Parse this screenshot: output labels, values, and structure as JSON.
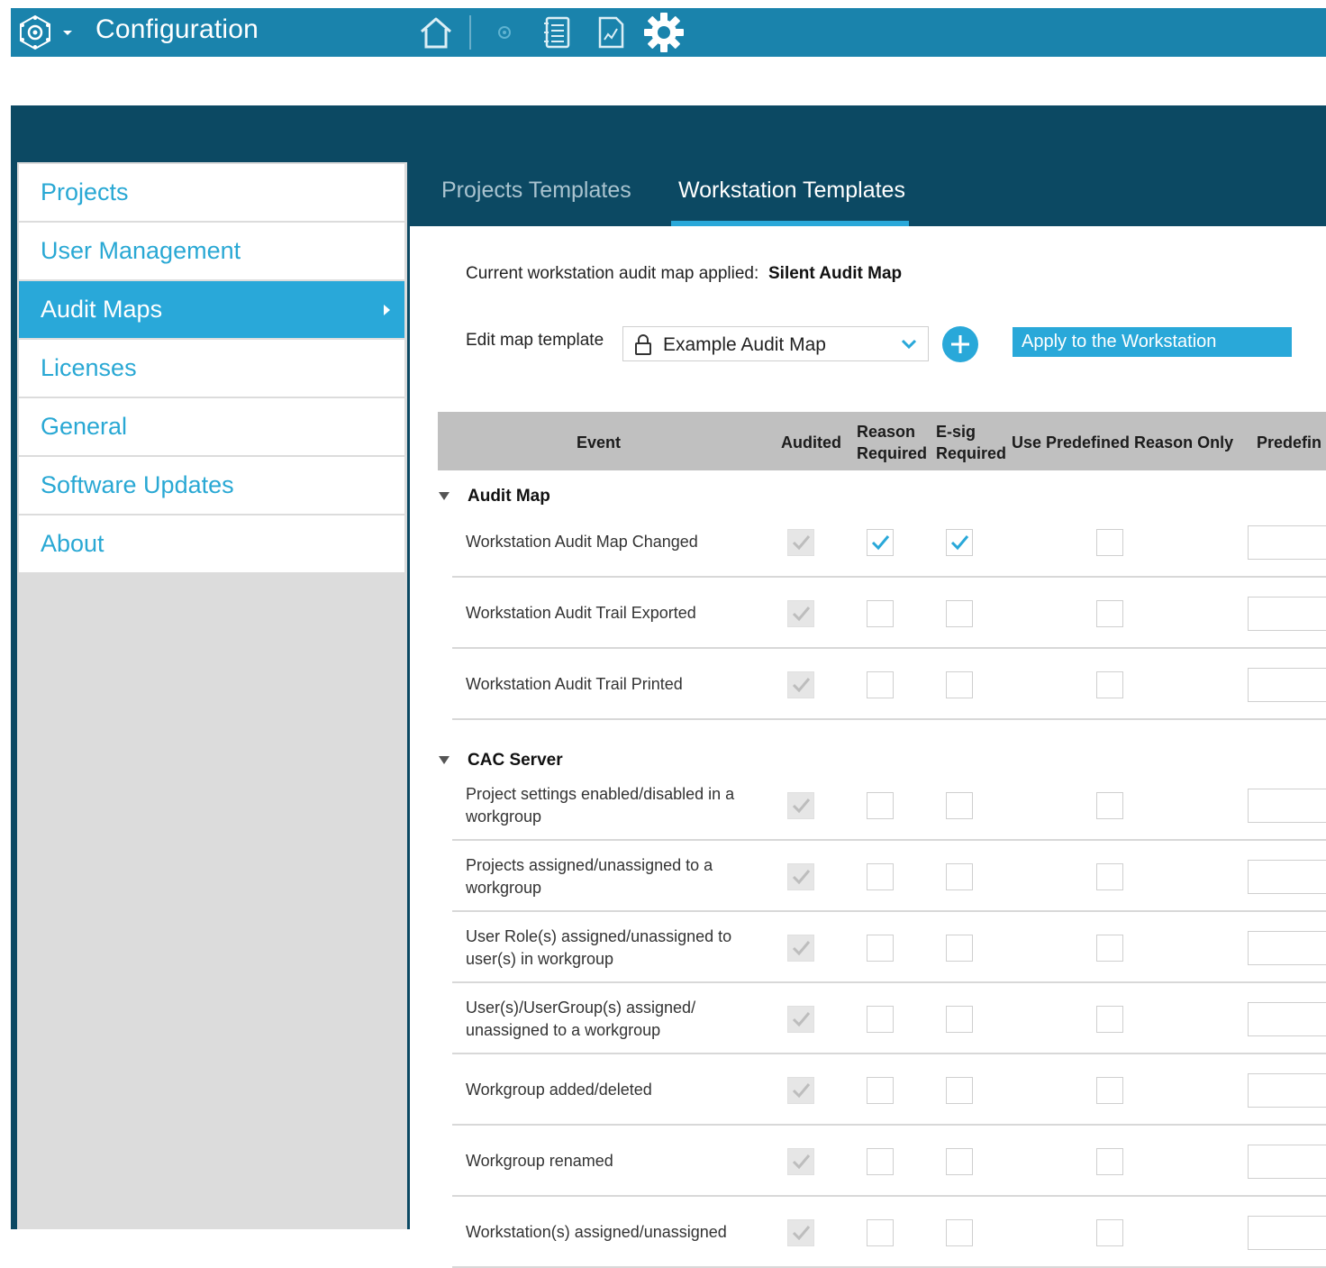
{
  "app": {
    "title": "Configuration",
    "accent": "#1a83ac",
    "toolbar_icons": [
      "app-logo-icon",
      "dropdown-caret-icon",
      "home-icon",
      "small-gear-icon",
      "notebook-icon",
      "report-icon",
      "settings-gear-icon"
    ]
  },
  "sidebar": {
    "items": [
      {
        "label": "Projects"
      },
      {
        "label": "User Management"
      },
      {
        "label": "Audit Maps",
        "active": true
      },
      {
        "label": "Licenses"
      },
      {
        "label": "General"
      },
      {
        "label": "Software Updates"
      },
      {
        "label": "About"
      }
    ]
  },
  "tabs": [
    {
      "label": "Projects Templates"
    },
    {
      "label": "Workstation Templates",
      "active": true
    }
  ],
  "current": {
    "label": "Current workstation audit map applied:",
    "value": "Silent Audit Map"
  },
  "edit": {
    "label": "Edit map template",
    "selected": "Example Audit Map",
    "apply_label": "Apply to the Workstation"
  },
  "table": {
    "headers": {
      "event": "Event",
      "audited": "Audited",
      "reason_1": "Reason",
      "reason_2": "Required",
      "esig_1": "E-sig",
      "esig_2": "Required",
      "predefined_only": "Use Predefined Reason Only",
      "predefined": "Predefin"
    },
    "groups": [
      {
        "title": "Audit Map",
        "rows": [
          {
            "event": "Workstation Audit Map Changed",
            "audited": true,
            "reason": true,
            "esig": true,
            "predefined_only": false
          },
          {
            "event": "Workstation Audit Trail Exported",
            "audited": true,
            "reason": false,
            "esig": false,
            "predefined_only": false
          },
          {
            "event": "Workstation Audit Trail Printed",
            "audited": true,
            "reason": false,
            "esig": false,
            "predefined_only": false
          }
        ]
      },
      {
        "title": "CAC Server",
        "rows": [
          {
            "event": "Project settings enabled/disabled in a workgroup",
            "audited": true,
            "reason": false,
            "esig": false,
            "predefined_only": false
          },
          {
            "event": "Projects assigned/unassigned to a workgroup",
            "audited": true,
            "reason": false,
            "esig": false,
            "predefined_only": false
          },
          {
            "event": "User Role(s) assigned/unassigned to user(s) in workgroup",
            "audited": true,
            "reason": false,
            "esig": false,
            "predefined_only": false
          },
          {
            "event": "User(s)/UserGroup(s) assigned/ unassigned to a workgroup",
            "audited": true,
            "reason": false,
            "esig": false,
            "predefined_only": false
          },
          {
            "event": "Workgroup added/deleted",
            "audited": true,
            "reason": false,
            "esig": false,
            "predefined_only": false
          },
          {
            "event": "Workgroup renamed",
            "audited": true,
            "reason": false,
            "esig": false,
            "predefined_only": false
          },
          {
            "event": "Workstation(s) assigned/unassigned",
            "audited": true,
            "reason": false,
            "esig": false,
            "predefined_only": false
          }
        ]
      }
    ]
  }
}
